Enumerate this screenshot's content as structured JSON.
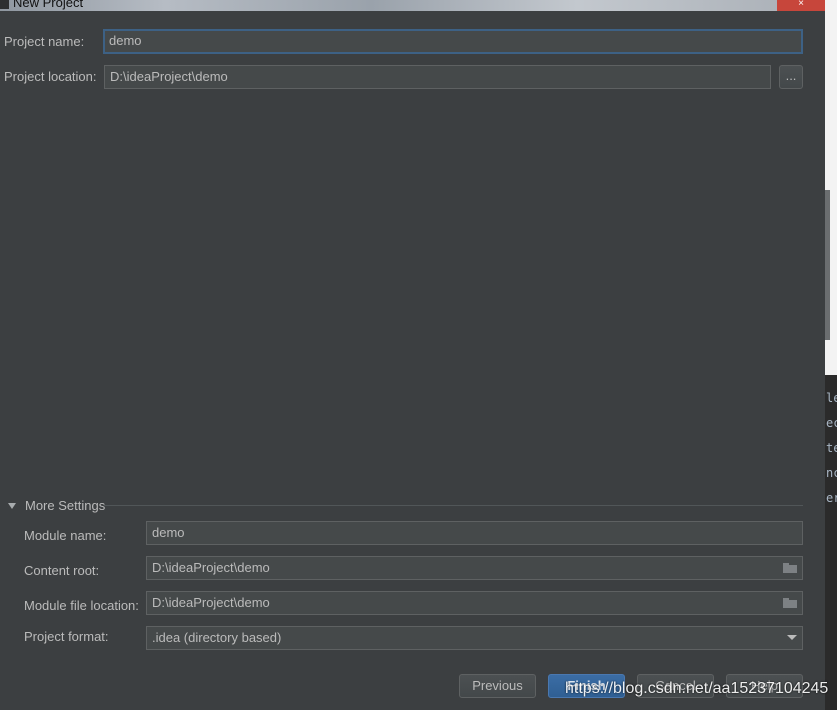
{
  "window": {
    "title": "New Project",
    "close": "×"
  },
  "form": {
    "project_name": {
      "label": "Project name:",
      "value": "demo"
    },
    "project_location": {
      "label": "Project location:",
      "value": "D:\\ideaProject\\demo",
      "browse": "..."
    }
  },
  "more_settings": {
    "label": "More Settings",
    "module_name": {
      "label": "Module name:",
      "value": "demo"
    },
    "content_root": {
      "label": "Content root:",
      "value": "D:\\ideaProject\\demo"
    },
    "module_file_location": {
      "label": "Module file location:",
      "value": "D:\\ideaProject\\demo"
    },
    "project_format": {
      "label": "Project format:",
      "value": ".idea (directory based)"
    }
  },
  "buttons": {
    "previous": "Previous",
    "finish": "Finish",
    "cancel": "Cancel",
    "help": "Help"
  },
  "watermark": "https://blog.csdn.net/aa15237104245",
  "background_editor": {
    "fragments": [
      "le",
      "ec",
      "te",
      "nc",
      "er"
    ]
  },
  "colors": {
    "dialog_bg": "#3c3f41",
    "field_bg": "#45494a",
    "focus_border": "#3d6185",
    "primary_button": "#365880"
  }
}
